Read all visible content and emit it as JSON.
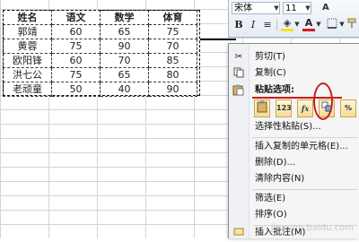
{
  "table": {
    "headers": [
      "姓名",
      "语文",
      "数学",
      "体育"
    ],
    "rows": [
      [
        "郭靖",
        "60",
        "65",
        "75"
      ],
      [
        "黄蓉",
        "75",
        "90",
        "70"
      ],
      [
        "欧阳锋",
        "60",
        "70",
        "85"
      ],
      [
        "洪七公",
        "75",
        "65",
        "80"
      ],
      [
        "老顽童",
        "50",
        "40",
        "90"
      ]
    ]
  },
  "mini_toolbar": {
    "font_name": "宋体",
    "font_size": "11",
    "grow_font": "A",
    "bold": "B",
    "italic": "I",
    "align": "≡",
    "fill_color": "◈",
    "font_color": "A",
    "fill_color_hex": "#f2e320",
    "font_color_hex": "#d21a1a"
  },
  "context_menu": {
    "cut": "剪切(T)",
    "copy": "复制(C)",
    "paste_options": "粘贴选项:",
    "paste_icons": [
      "",
      "123",
      "fx",
      "",
      "%"
    ],
    "paste_special": "选择性粘贴(S)...",
    "insert_copied": "插入复制的单元格(E)...",
    "delete": "删除(D)...",
    "clear": "清除内容(N)",
    "filter": "筛选(E)",
    "sort": "排序(O)",
    "insert_comment": "插入批注(M)"
  },
  "watermark": "jingyan.baidu.com"
}
